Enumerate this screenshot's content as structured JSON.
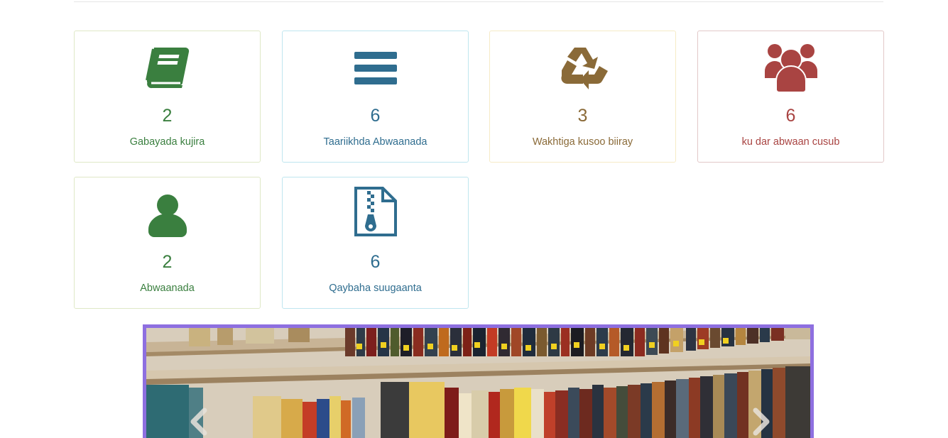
{
  "cards": [
    {
      "count": "2",
      "label": "Gabayada kujira",
      "icon": "book-icon",
      "color": "#3a7f3f"
    },
    {
      "count": "6",
      "label": "Taariikhda Abwaanada",
      "icon": "bars-icon",
      "color": "#2f6d8f"
    },
    {
      "count": "3",
      "label": "Wakhtiga kusoo biiray",
      "icon": "recycle-icon",
      "color": "#8a6a38"
    },
    {
      "count": "6",
      "label": "ku dar abwaan cusub",
      "icon": "users-icon",
      "color": "#a94442"
    },
    {
      "count": "2",
      "label": "Abwaanada",
      "icon": "user-icon",
      "color": "#3a7f3f"
    },
    {
      "count": "6",
      "label": "Qaybaha suugaanta",
      "icon": "zip-file-icon",
      "color": "#2f6d8f"
    }
  ],
  "carousel": {
    "image": "library-bookshelf-photo",
    "border_color": "#8e6fe0",
    "prev_icon": "chevron-left-icon",
    "next_icon": "chevron-right-icon"
  }
}
